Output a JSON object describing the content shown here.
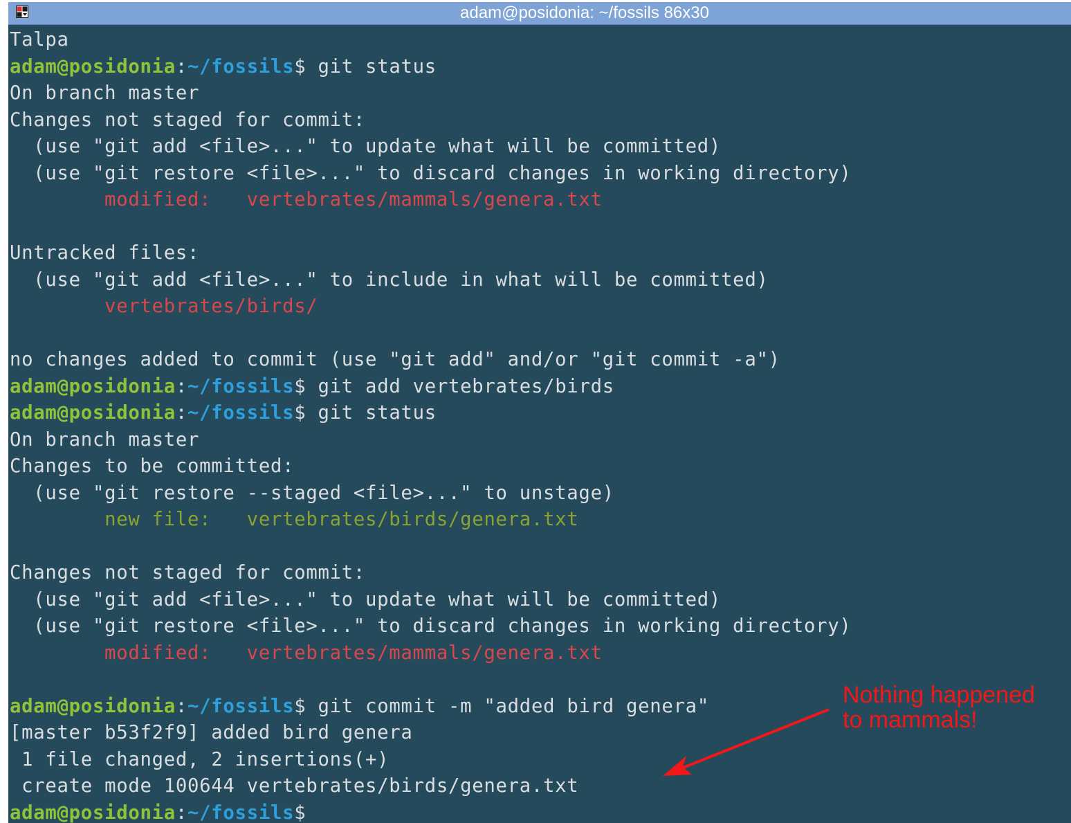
{
  "window": {
    "title": "adam@posidonia: ~/fossils 86x30",
    "system_menu_icon": "window-menu-icon"
  },
  "prompt": {
    "user_host": "adam@posidonia",
    "sep": ":",
    "path": "~/fossils",
    "sigil": "$"
  },
  "terminal": {
    "lines": [
      {
        "segs": [
          {
            "t": "Talpa",
            "c": "plain"
          }
        ]
      },
      {
        "prompt": true,
        "cmd": " git status"
      },
      {
        "segs": [
          {
            "t": "On branch master",
            "c": "plain"
          }
        ]
      },
      {
        "segs": [
          {
            "t": "Changes not staged for commit:",
            "c": "plain"
          }
        ]
      },
      {
        "segs": [
          {
            "t": "  (use \"git add <file>...\" to update what will be committed)",
            "c": "plain"
          }
        ]
      },
      {
        "segs": [
          {
            "t": "  (use \"git restore <file>...\" to discard changes in working directory)",
            "c": "plain"
          }
        ]
      },
      {
        "segs": [
          {
            "t": "        modified:   vertebrates/mammals/genera.txt",
            "c": "red"
          }
        ]
      },
      {
        "segs": [
          {
            "t": "",
            "c": "plain"
          }
        ]
      },
      {
        "segs": [
          {
            "t": "Untracked files:",
            "c": "plain"
          }
        ]
      },
      {
        "segs": [
          {
            "t": "  (use \"git add <file>...\" to include in what will be committed)",
            "c": "plain"
          }
        ]
      },
      {
        "segs": [
          {
            "t": "        vertebrates/birds/",
            "c": "red"
          }
        ]
      },
      {
        "segs": [
          {
            "t": "",
            "c": "plain"
          }
        ]
      },
      {
        "segs": [
          {
            "t": "no changes added to commit (use \"git add\" and/or \"git commit -a\")",
            "c": "plain"
          }
        ]
      },
      {
        "prompt": true,
        "cmd": " git add vertebrates/birds"
      },
      {
        "prompt": true,
        "cmd": " git status"
      },
      {
        "segs": [
          {
            "t": "On branch master",
            "c": "plain"
          }
        ]
      },
      {
        "segs": [
          {
            "t": "Changes to be committed:",
            "c": "plain"
          }
        ]
      },
      {
        "segs": [
          {
            "t": "  (use \"git restore --staged <file>...\" to unstage)",
            "c": "plain"
          }
        ]
      },
      {
        "segs": [
          {
            "t": "        new file:   vertebrates/birds/genera.txt",
            "c": "olive"
          }
        ]
      },
      {
        "segs": [
          {
            "t": "",
            "c": "plain"
          }
        ]
      },
      {
        "segs": [
          {
            "t": "Changes not staged for commit:",
            "c": "plain"
          }
        ]
      },
      {
        "segs": [
          {
            "t": "  (use \"git add <file>...\" to update what will be committed)",
            "c": "plain"
          }
        ]
      },
      {
        "segs": [
          {
            "t": "  (use \"git restore <file>...\" to discard changes in working directory)",
            "c": "plain"
          }
        ]
      },
      {
        "segs": [
          {
            "t": "        modified:   vertebrates/mammals/genera.txt",
            "c": "red"
          }
        ]
      },
      {
        "segs": [
          {
            "t": "",
            "c": "plain"
          }
        ]
      },
      {
        "prompt": true,
        "cmd": " git commit -m \"added bird genera\""
      },
      {
        "segs": [
          {
            "t": "[master b53f2f9] added bird genera",
            "c": "plain"
          }
        ]
      },
      {
        "segs": [
          {
            "t": " 1 file changed, 2 insertions(+)",
            "c": "plain"
          }
        ]
      },
      {
        "segs": [
          {
            "t": " create mode 100644 vertebrates/birds/genera.txt",
            "c": "plain"
          }
        ]
      },
      {
        "prompt": true,
        "cmd": ""
      }
    ]
  },
  "annotation": {
    "line1": "Nothing happened",
    "line2": "to mammals!",
    "color": "#f01818"
  },
  "colors": {
    "background": "#254a5c",
    "titlebar": "#7ea3d6",
    "prompt_user": "#8fc43a",
    "prompt_path": "#2e9fdb",
    "modified": "#d8474c",
    "staged": "#8aa232"
  }
}
